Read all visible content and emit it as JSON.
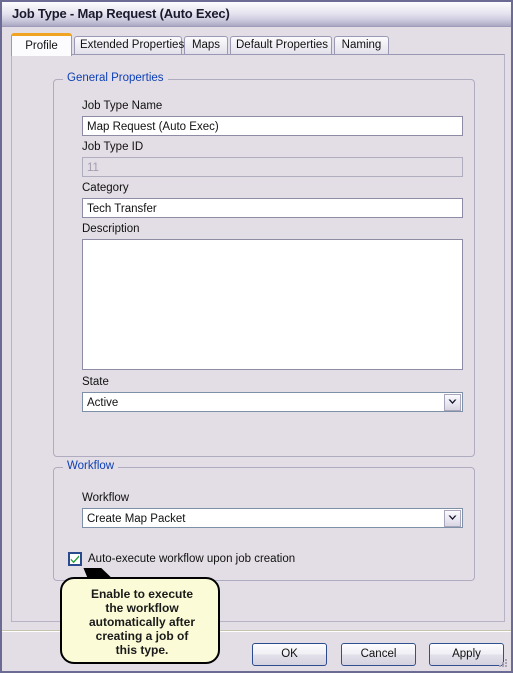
{
  "window": {
    "title": "Job Type - Map Request (Auto Exec)"
  },
  "tabs": [
    {
      "label": "Profile",
      "active": true
    },
    {
      "label": "Extended Properties",
      "active": false
    },
    {
      "label": "Maps",
      "active": false
    },
    {
      "label": "Default Properties",
      "active": false
    },
    {
      "label": "Naming",
      "active": false
    }
  ],
  "general_properties": {
    "legend": "General Properties",
    "job_type_name": {
      "label": "Job Type Name",
      "value": "Map Request (Auto Exec)",
      "placeholder": ""
    },
    "job_type_id": {
      "label": "Job Type ID",
      "value": "11",
      "disabled": true
    },
    "category": {
      "label": "Category",
      "value": "Tech Transfer",
      "placeholder": ""
    },
    "description": {
      "label": "Description",
      "value": "",
      "placeholder": ""
    },
    "state": {
      "label": "State",
      "value": "Active",
      "options": [
        "Active"
      ]
    }
  },
  "workflow_section": {
    "legend": "Workflow",
    "workflow": {
      "label": "Workflow",
      "value": "Create Map Packet",
      "options": [
        "Create Map Packet"
      ]
    },
    "auto_execute": {
      "label": "Auto-execute workflow upon job creation",
      "checked": true
    }
  },
  "callout": {
    "text": "Enable to execute\nthe workflow\nautomatically after\ncreating a job of\nthis type."
  },
  "footer": {
    "ok_label": "OK",
    "cancel_label": "Cancel",
    "apply_label": "Apply"
  },
  "icons": {
    "chevron_down": "chevron-down-icon",
    "check": "check-icon",
    "resize_grip": "resize-grip-icon"
  },
  "colors": {
    "panel_bg": "#e3dee5",
    "group_label": "#0d3fb5",
    "active_tab_accent": "#f0a422",
    "callout_bg": "#fbfbd8",
    "check_green": "#1e9e2e",
    "button_border": "#2a4b8d"
  }
}
